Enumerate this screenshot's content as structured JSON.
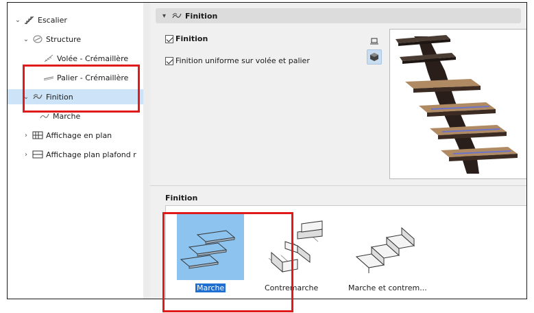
{
  "tree": {
    "items": [
      {
        "label": "Escalier",
        "level": 0,
        "expanded": true
      },
      {
        "label": "Structure",
        "level": 1,
        "expanded": true
      },
      {
        "label": "Volée - Crémaillère",
        "level": 2
      },
      {
        "label": "Palier - Crémaillère",
        "level": 2
      },
      {
        "label": "Finition",
        "level": 1,
        "expanded": true,
        "selected": true
      },
      {
        "label": "Marche",
        "level": 2
      },
      {
        "label": "Affichage en plan",
        "level": 1,
        "expanded": false
      },
      {
        "label": "Affichage plan plafond r",
        "level": 1,
        "expanded": false
      }
    ]
  },
  "panel": {
    "header_label": "Finition",
    "checkbox_finition": {
      "label": "Finition",
      "checked": true
    },
    "checkbox_uniform": {
      "label": "Finition uniforme sur volée et palier",
      "checked": true
    },
    "view_buttons": [
      {
        "icon": "plan-view-icon",
        "active": false
      },
      {
        "icon": "3d-view-icon",
        "active": true
      }
    ]
  },
  "finition_section": {
    "title": "Finition",
    "options": [
      {
        "label": "Marche",
        "selected": true
      },
      {
        "label": "Contremarche",
        "selected": false
      },
      {
        "label": "Marche et contrem...",
        "selected": false
      }
    ]
  },
  "colors": {
    "highlight": "#e0191a",
    "selection": "#cde3f7",
    "gallery_selection": "#8cc3ef"
  }
}
